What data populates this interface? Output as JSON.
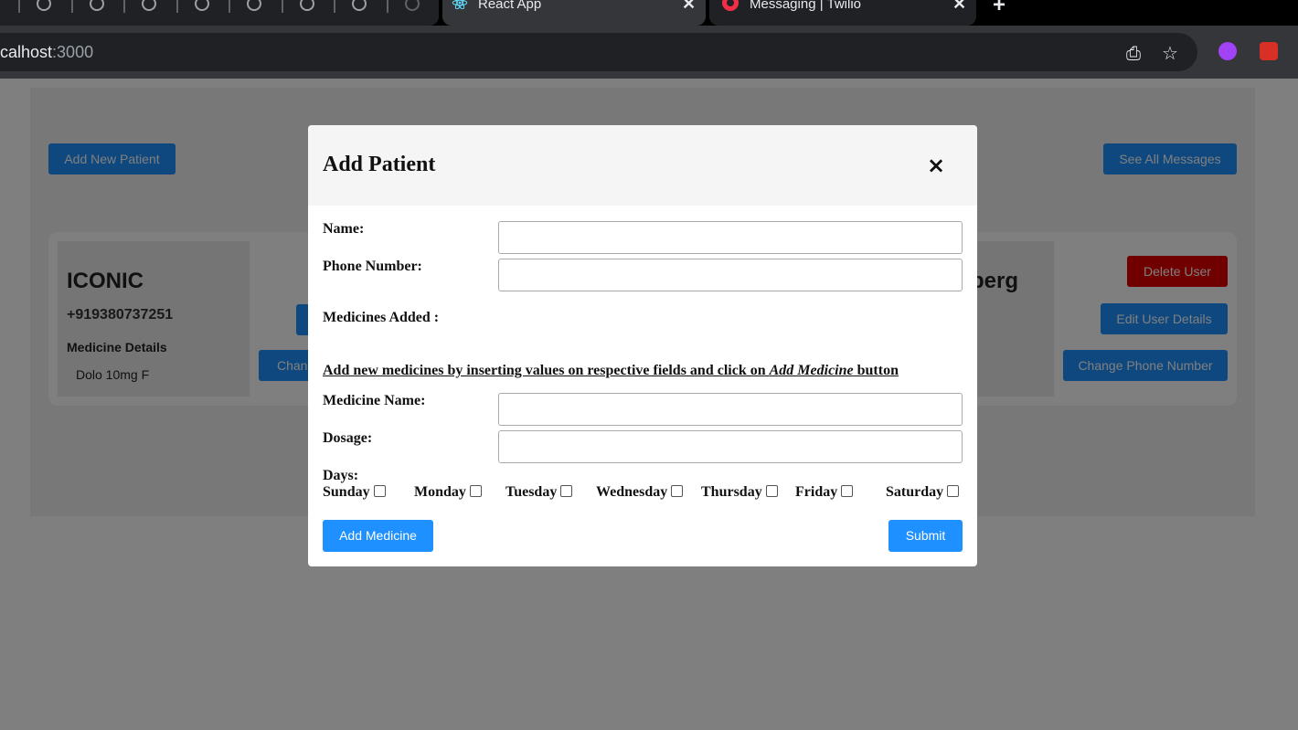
{
  "browser": {
    "active_tab_title": "React App",
    "second_tab_title": "Messaging | Twilio",
    "url_host": "calhost",
    "url_port": ":3000"
  },
  "page": {
    "add_patient_button": "Add New Patient",
    "see_messages_button": "See All Messages",
    "patient": {
      "name": "ICONIC",
      "phone": "+919380737251",
      "medicine_title": "Medicine Details",
      "medicine_item": "Dolo 10mg F"
    },
    "partial_button": "Chang",
    "right_name_fragment": "berg",
    "delete_button": "Delete User",
    "edit_button": "Edit User Details",
    "change_phone_button": "Change Phone Number"
  },
  "modal": {
    "title": "Add Patient",
    "close": "×",
    "name_label": "Name:",
    "name_value": "",
    "phone_label": "Phone Number:",
    "phone_value": "",
    "medicines_added_label": "Medicines Added :",
    "instruction_prefix": "Add new medicines by inserting values on respective fields and click on ",
    "instruction_em": "Add Medicine",
    "instruction_suffix": " button",
    "medicine_name_label": "Medicine Name:",
    "medicine_name_value": "",
    "dosage_label": "Dosage:",
    "dosage_value": "",
    "days_label": "Days:",
    "days": [
      "Sunday",
      "Monday",
      "Tuesday",
      "Wednesday",
      "Thursday",
      "Friday",
      "Saturday"
    ],
    "add_medicine_button": "Add Medicine",
    "submit_button": "Submit"
  },
  "colors": {
    "primary_button": "#1e90ff",
    "danger_button": "#e00000",
    "overlay": "rgba(0,0,0,0.5)"
  }
}
